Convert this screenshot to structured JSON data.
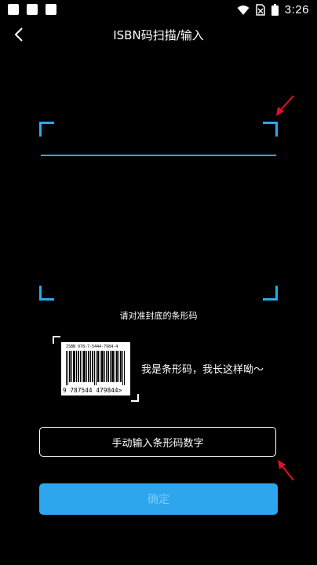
{
  "status_bar": {
    "time": "3:26"
  },
  "header": {
    "title": "ISBN码扫描/输入"
  },
  "scanner": {
    "hint": "请对准封底的条形码"
  },
  "example": {
    "isbn_line": "ISBN 978-7-5444-7984-4",
    "digits": "9 787544 479844>",
    "caption": "我是条形码，我长这样呦～"
  },
  "actions": {
    "manual_input_label": "手动输入条形码数字",
    "confirm_label": "确定"
  },
  "colors": {
    "accent": "#2aa8ef",
    "confirm_bg": "#2ea6ee",
    "confirm_text_disabled": "#7ec8f5",
    "annotation_arrow": "#e0102a"
  }
}
